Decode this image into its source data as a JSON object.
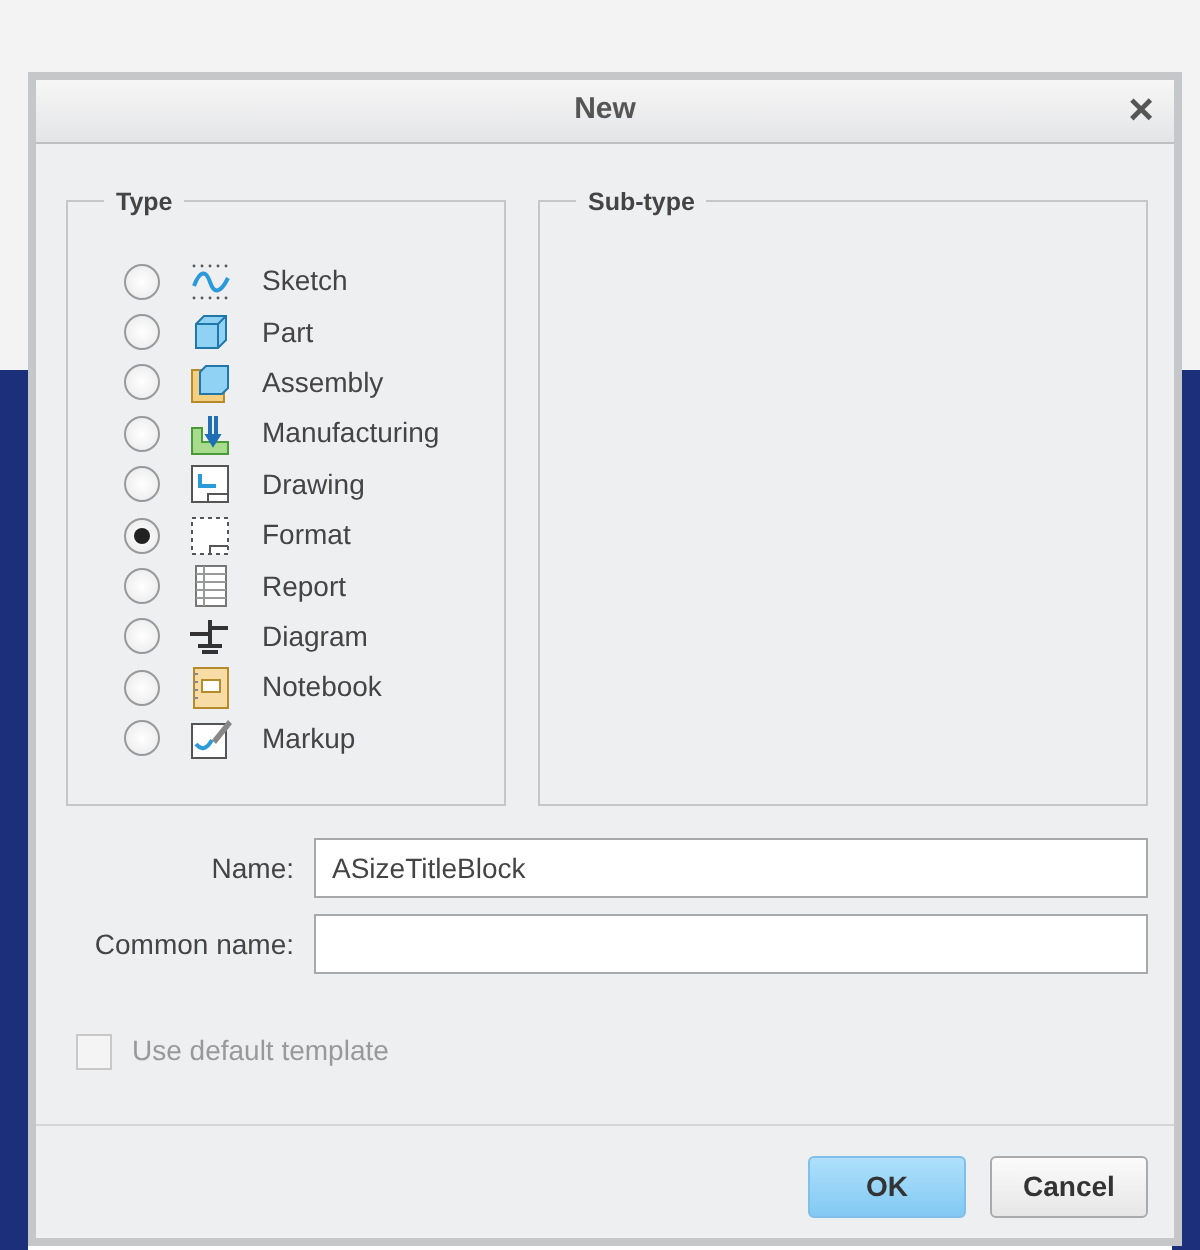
{
  "window": {
    "title": "New",
    "close": "×"
  },
  "type_group": {
    "title": "Type",
    "items": [
      {
        "label": "Sketch",
        "selected": false
      },
      {
        "label": "Part",
        "selected": false
      },
      {
        "label": "Assembly",
        "selected": false
      },
      {
        "label": "Manufacturing",
        "selected": false
      },
      {
        "label": "Drawing",
        "selected": false
      },
      {
        "label": "Format",
        "selected": true
      },
      {
        "label": "Report",
        "selected": false
      },
      {
        "label": "Diagram",
        "selected": false
      },
      {
        "label": "Notebook",
        "selected": false
      },
      {
        "label": "Markup",
        "selected": false
      }
    ]
  },
  "subtype_group": {
    "title": "Sub-type"
  },
  "fields": [
    {
      "label": "Name:",
      "value": "ASizeTitleBlock"
    },
    {
      "label": "Common name:"
    }
  ],
  "use_default_template": {
    "label": "Use default template",
    "checked": false,
    "disabled": true
  },
  "buttons": [
    {
      "label": "OK",
      "primary": true
    },
    {
      "label": "Cancel",
      "primary": false
    }
  ]
}
